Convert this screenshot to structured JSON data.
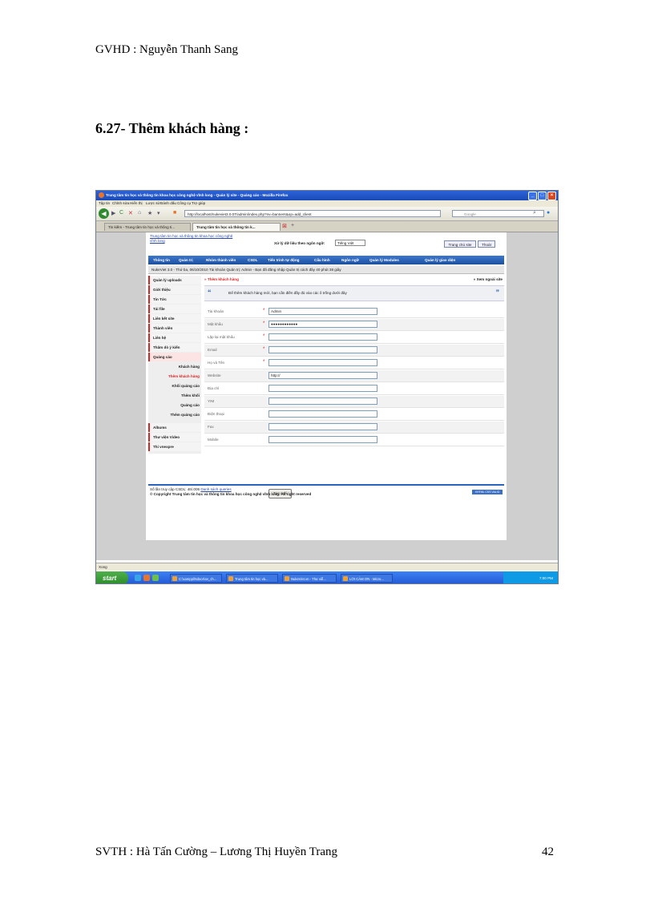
{
  "document": {
    "header": "GVHD : Nguyễn Thanh Sang",
    "section_heading": "6.27- Thêm khách hàng :",
    "footer_left": "SVTH : Hà Tấn Cường – Lương Thị Huyền Trang",
    "page_number": "42"
  },
  "browser": {
    "title": "Trung tâm tin học và thông tin khoa học công nghệ vĩnh long - Quản lý site - Quảng cáo - Mozilla Firefox",
    "menu": [
      "Tập tin",
      "Chỉnh sửa",
      "Hiển thị",
      "Lược sử",
      "Đánh dấu",
      "Công cụ",
      "Trợ giúp"
    ],
    "url": "http://localhost/nukeviet3.0.0T/admin/index.php?nv=banners&op=add_client",
    "search_placeholder": "Google",
    "tabs": [
      "Tin kiếm - Trung tâm tin học và thông ti...",
      "Trung tâm tin học và thông tin k..."
    ],
    "status": "Xong"
  },
  "site": {
    "logo": "Trung tâm tin học và thông tin khoa học công nghệ vĩnh long",
    "lang_label": "Xử lý dữ liệu theo ngôn ngữ:",
    "lang_value": "Tiếng Việt",
    "home_btn": "Trang chủ site",
    "exit_btn": "Thoát",
    "nav": [
      "Thông tin",
      "Quản trị",
      "Nhóm thành viên",
      "CSDL",
      "Tiến trình tự động",
      "Cấu hình",
      "Ngôn ngữ",
      "Quản lý Modules",
      "Quản lý giao diện"
    ],
    "version": "NukeViet 3.0 - Thứ ba, 06/10/2010",
    "login_info": "Tài khoản Quản trị: Admin - Bạn đã đăng nhập Quản trị cách đây 40 phút 38 giây",
    "sidebar": [
      "Quản lý uploads",
      "Giới thiệu",
      "Tin Tức",
      "Tải file",
      "Liên kết site",
      "Thành viên",
      "Liên hệ",
      "Thăm dò ý kiến",
      "Quảng cáo"
    ],
    "sidebar_sub": [
      "Khách hàng",
      "Thêm khách hàng",
      "Khối quảng cáo",
      "Thêm khối",
      "Quảng cáo",
      "Thêm quảng cáo"
    ],
    "sidebar_bottom": [
      "Albums",
      "Thư viện Video",
      "Thi vnexpre"
    ],
    "page_title": "» Thêm khách hàng",
    "view_site": "» Xem ngoài site",
    "note": "Để thêm khách hàng mới, bạn cần điền đầy đủ vào các ô trống dưới đây",
    "form": [
      {
        "label": "Tài khoản",
        "required": "*",
        "value": "Admin"
      },
      {
        "label": "Mật khẩu",
        "required": "*",
        "value": "●●●●●●●●●●●●"
      },
      {
        "label": "Lặp lại mật khẩu",
        "required": "*",
        "value": ""
      },
      {
        "label": "Email",
        "required": "*",
        "value": ""
      },
      {
        "label": "Họ và Tên",
        "required": "*",
        "value": ""
      },
      {
        "label": "Website",
        "required": "",
        "value": "http://"
      },
      {
        "label": "Địa chỉ",
        "required": "",
        "value": ""
      },
      {
        "label": "YIM",
        "required": "",
        "value": ""
      },
      {
        "label": "Điện thoại",
        "required": "",
        "value": ""
      },
      {
        "label": "Fax",
        "required": "",
        "value": ""
      },
      {
        "label": "Mobile",
        "required": "",
        "value": ""
      }
    ],
    "submit": "Tạo mới",
    "footer_queries": "Số lần truy cập CSDL: 46/.006",
    "footer_link": "Danh sách queries",
    "copyright": "© Copyright Trung tâm tin học và thông tin khoa học công nghệ vĩnh long. All right reserved",
    "valid_badge": "XHTML CSS VALID"
  },
  "taskbar": {
    "start": "start",
    "tasks": [
      "C:\\xampp\\htdocs\\nv_ch...",
      "Trung tâm tin học và...",
      "NukeViet.vn - Thư viễ...",
      "LỜI CẢM ƠN - Micro..."
    ],
    "clock": "7:00 PM"
  }
}
